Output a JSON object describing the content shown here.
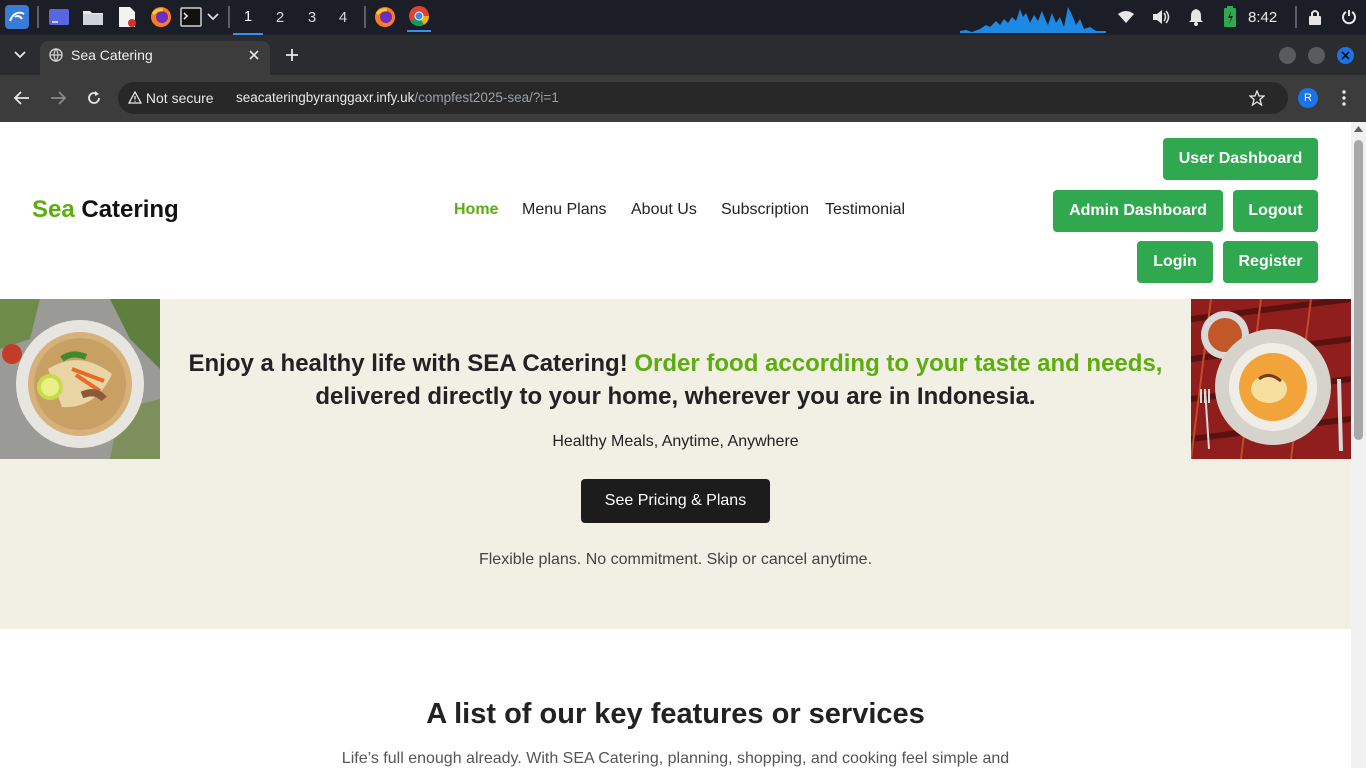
{
  "taskbar": {
    "workspaces": [
      "1",
      "2",
      "3",
      "4"
    ],
    "clock": "8:42",
    "icons": [
      "kali-menu-icon",
      "desktop-icon",
      "file-manager-icon",
      "text-editor-icon",
      "firefox-icon",
      "terminal-icon",
      "firefox-icon",
      "chrome-icon",
      "wifi-icon",
      "volume-icon",
      "bell-icon",
      "battery-icon",
      "lock-icon",
      "power-icon"
    ]
  },
  "browser": {
    "tab_title": "Sea Catering",
    "security_label": "Not secure",
    "url_host": "seacateringbyranggaxr.infy.uk",
    "url_path": "/compfest2025-sea/?i=1",
    "profile_initial": "R"
  },
  "site": {
    "brand_accent": "Sea",
    "brand_rest": " Catering",
    "nav": [
      "Home",
      "Menu Plans",
      "About Us",
      "Subscription",
      "Testimonial"
    ],
    "buttons": {
      "user_dashboard": "User Dashboard",
      "admin_dashboard": "Admin Dashboard",
      "logout": "Logout",
      "login": "Login",
      "register": "Register"
    },
    "hero": {
      "title_part1": "Enjoy a healthy life with SEA Catering! ",
      "title_accent": "Order food according to your taste and needs,",
      "title_part2": "delivered directly to your home, wherever you are in Indonesia.",
      "subtitle": "Healthy Meals, Anytime, Anywhere",
      "cta": "See Pricing & Plans",
      "note": "Flexible plans. No commitment. Skip or cancel anytime."
    },
    "features": {
      "title": "A list of our key features or services",
      "text": "Life’s full enough already. With SEA Catering, planning, shopping, and cooking feel simple and"
    }
  },
  "colors": {
    "brand_green": "#5cad0e",
    "button_green": "#2fa84f",
    "hero_bg": "#f2efe4",
    "cta_bg": "#1c1c1c"
  }
}
